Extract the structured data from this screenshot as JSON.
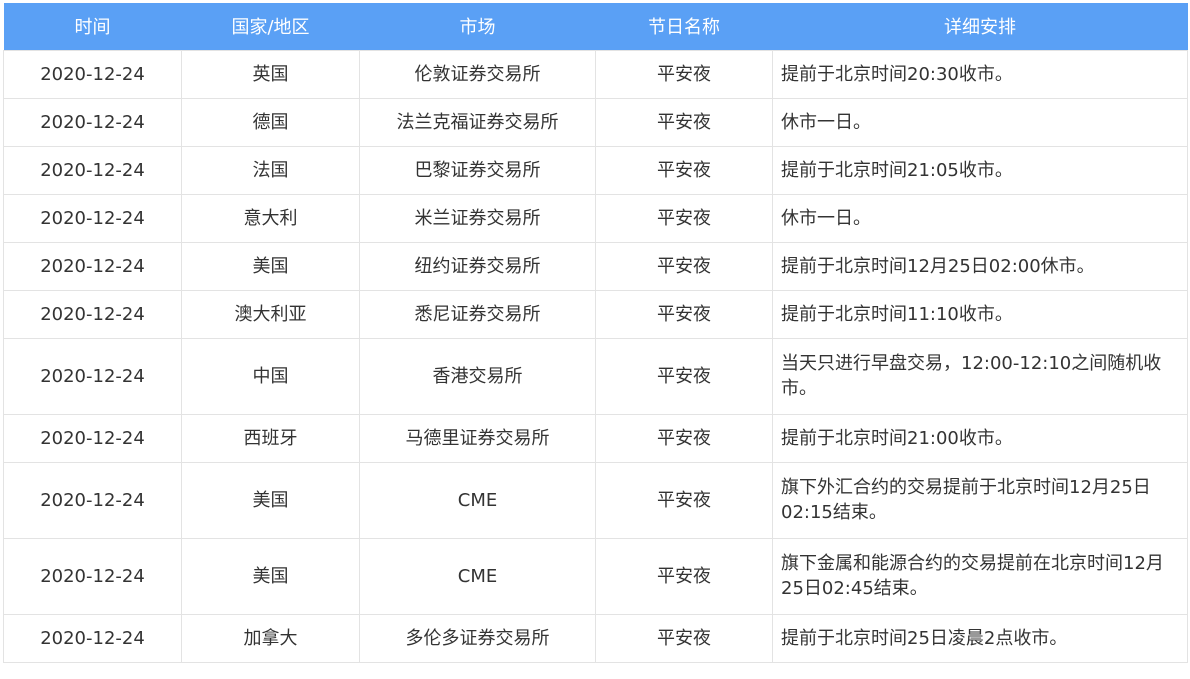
{
  "headers": {
    "date": "时间",
    "country": "国家/地区",
    "market": "市场",
    "holiday": "节日名称",
    "detail": "详细安排"
  },
  "rows": [
    {
      "date": "2020-12-24",
      "country": "英国",
      "market": "伦敦证券交易所",
      "holiday": "平安夜",
      "detail": "提前于北京时间20:30收市。"
    },
    {
      "date": "2020-12-24",
      "country": "德国",
      "market": "法兰克福证券交易所",
      "holiday": "平安夜",
      "detail": "休市一日。"
    },
    {
      "date": "2020-12-24",
      "country": "法国",
      "market": "巴黎证券交易所",
      "holiday": "平安夜",
      "detail": "提前于北京时间21:05收市。"
    },
    {
      "date": "2020-12-24",
      "country": "意大利",
      "market": "米兰证券交易所",
      "holiday": "平安夜",
      "detail": "休市一日。"
    },
    {
      "date": "2020-12-24",
      "country": "美国",
      "market": "纽约证券交易所",
      "holiday": "平安夜",
      "detail": "提前于北京时间12月25日02:00休市。"
    },
    {
      "date": "2020-12-24",
      "country": "澳大利亚",
      "market": "悉尼证券交易所",
      "holiday": "平安夜",
      "detail": "提前于北京时间11:10收市。"
    },
    {
      "date": "2020-12-24",
      "country": "中国",
      "market": "香港交易所",
      "holiday": "平安夜",
      "detail": "当天只进行早盘交易，12:00-12:10之间随机收市。"
    },
    {
      "date": "2020-12-24",
      "country": "西班牙",
      "market": "马德里证券交易所",
      "holiday": "平安夜",
      "detail": "提前于北京时间21:00收市。"
    },
    {
      "date": "2020-12-24",
      "country": "美国",
      "market": "CME",
      "holiday": "平安夜",
      "detail": "旗下外汇合约的交易提前于北京时间12月25日02:15结束。"
    },
    {
      "date": "2020-12-24",
      "country": "美国",
      "market": "CME",
      "holiday": "平安夜",
      "detail": "旗下金属和能源合约的交易提前在北京时间12月25日02:45结束。"
    },
    {
      "date": "2020-12-24",
      "country": "加拿大",
      "market": "多伦多证券交易所",
      "holiday": "平安夜",
      "detail": "提前于北京时间25日凌晨2点收市。"
    }
  ]
}
